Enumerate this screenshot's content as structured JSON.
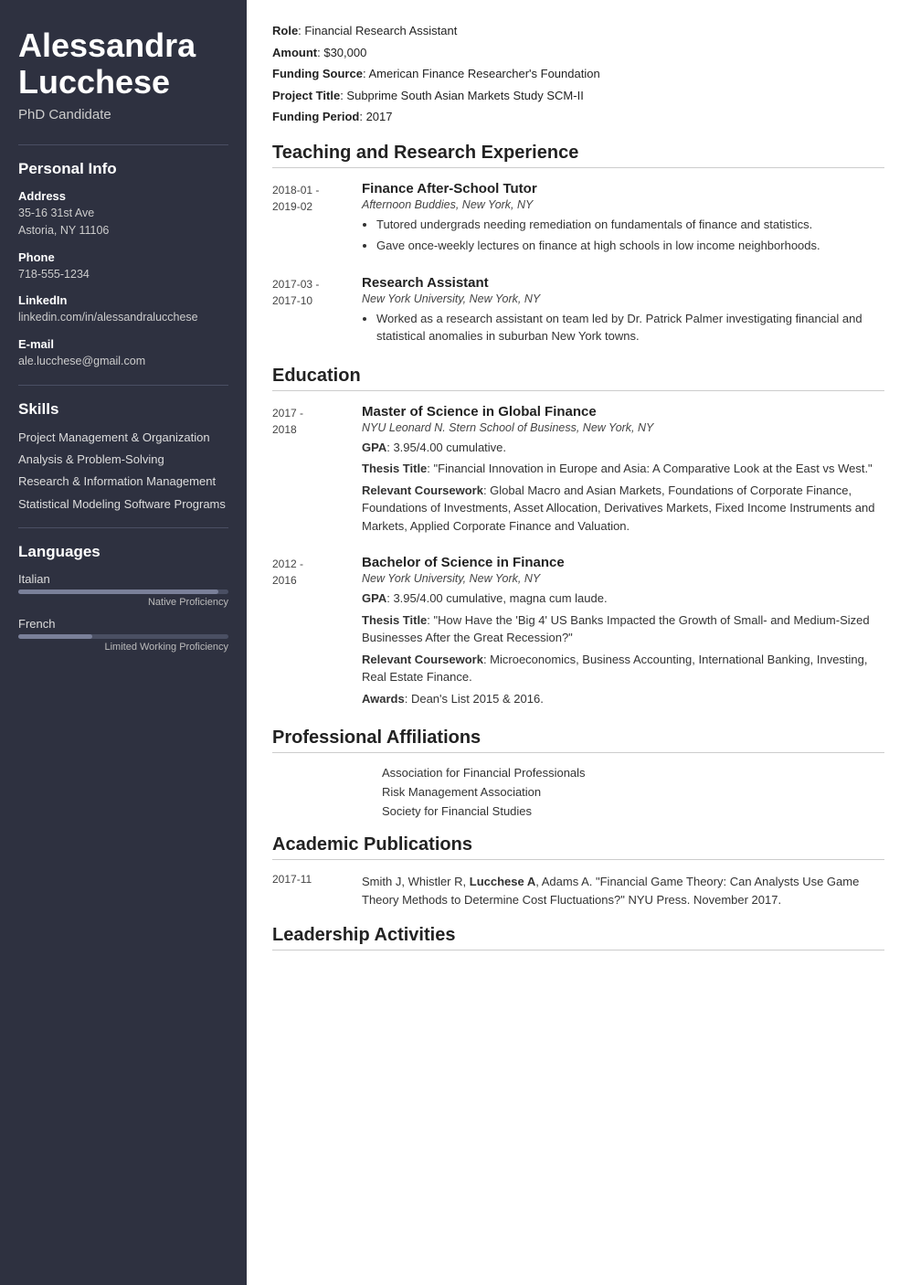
{
  "sidebar": {
    "name": "Alessandra Lucchese",
    "title": "PhD Candidate",
    "personal_info_heading": "Personal Info",
    "address_label": "Address",
    "address_value": "35-16 31st Ave\nAstoria, NY 11106",
    "phone_label": "Phone",
    "phone_value": "718-555-1234",
    "linkedin_label": "LinkedIn",
    "linkedin_value": "linkedin.com/in/alessandralucchese",
    "email_label": "E-mail",
    "email_value": "ale.lucchese@gmail.com",
    "skills_heading": "Skills",
    "skills": [
      "Project Management & Organization",
      "Analysis & Problem-Solving",
      "Research & Information Management",
      "Statistical Modeling Software Programs"
    ],
    "languages_heading": "Languages",
    "languages": [
      {
        "name": "Italian",
        "fill_pct": 95,
        "level": "Native Proficiency"
      },
      {
        "name": "French",
        "fill_pct": 35,
        "level": "Limited Working Proficiency"
      }
    ]
  },
  "main": {
    "funding_role_label": "Role",
    "funding_role_value": "Financial Research Assistant",
    "funding_amount_label": "Amount",
    "funding_amount_value": "$30,000",
    "funding_source_label": "Funding Source",
    "funding_source_value": "American Finance Researcher's Foundation",
    "funding_project_label": "Project Title",
    "funding_project_value": "Subprime South Asian Markets Study SCM-II",
    "funding_period_label": "Funding Period",
    "funding_period_value": "2017",
    "teaching_section": "Teaching and Research Experience",
    "teaching_jobs": [
      {
        "date": "2018-01 -\n2019-02",
        "title": "Finance After-School Tutor",
        "org": "Afternoon Buddies, New York, NY",
        "bullets": [
          "Tutored undergrads needing remediation on fundamentals of finance and statistics.",
          "Gave once-weekly lectures on finance at high schools in low income neighborhoods."
        ]
      },
      {
        "date": "2017-03 -\n2017-10",
        "title": "Research Assistant",
        "org": "New York University, New York, NY",
        "bullets": [
          "Worked as a research assistant on team led by Dr. Patrick Palmer investigating financial and statistical anomalies in suburban New York towns."
        ]
      }
    ],
    "education_section": "Education",
    "education_items": [
      {
        "date": "2017 -\n2018",
        "degree": "Master of Science in Global Finance",
        "org": "NYU Leonard N. Stern School of Business, New York, NY",
        "details": [
          {
            "key": "GPA",
            "value": "3.95/4.00 cumulative."
          },
          {
            "key": "Thesis Title",
            "value": ": \"Financial Innovation in Europe and Asia: A Comparative Look at the East vs West.\""
          },
          {
            "key": "Relevant Coursework",
            "value": ": Global Macro and Asian Markets, Foundations of Corporate Finance, Foundations of Investments, Asset Allocation, Derivatives Markets, Fixed Income Instruments and Markets, Applied Corporate Finance and Valuation."
          }
        ]
      },
      {
        "date": "2012 -\n2016",
        "degree": "Bachelor of Science in Finance",
        "org": "New York University, New York, NY",
        "details": [
          {
            "key": "GPA",
            "value": ": 3.95/4.00 cumulative, magna cum laude."
          },
          {
            "key": "Thesis Title",
            "value": ": \"How Have the 'Big 4' US Banks Impacted the Growth of Small- and Medium-Sized Businesses After the Great Recession?\""
          },
          {
            "key": "Relevant Coursework",
            "value": ": Microeconomics, Business Accounting, International Banking, Investing, Real Estate Finance."
          },
          {
            "key": "Awards",
            "value": ": Dean's List 2015 & 2016."
          }
        ]
      }
    ],
    "affiliations_section": "Professional Affiliations",
    "affiliations": [
      "Association for Financial Professionals",
      "Risk Management Association",
      "Society for Financial Studies"
    ],
    "publications_section": "Academic Publications",
    "publications": [
      {
        "date": "2017-11",
        "text_before": "Smith J, Whistler R, ",
        "text_bold": "Lucchese A",
        "text_after": ", Adams A. \"Financial Game Theory: Can Analysts Use Game Theory Methods to Determine Cost Fluctuations?\" NYU Press. November 2017."
      }
    ],
    "leadership_section": "Leadership Activities"
  }
}
